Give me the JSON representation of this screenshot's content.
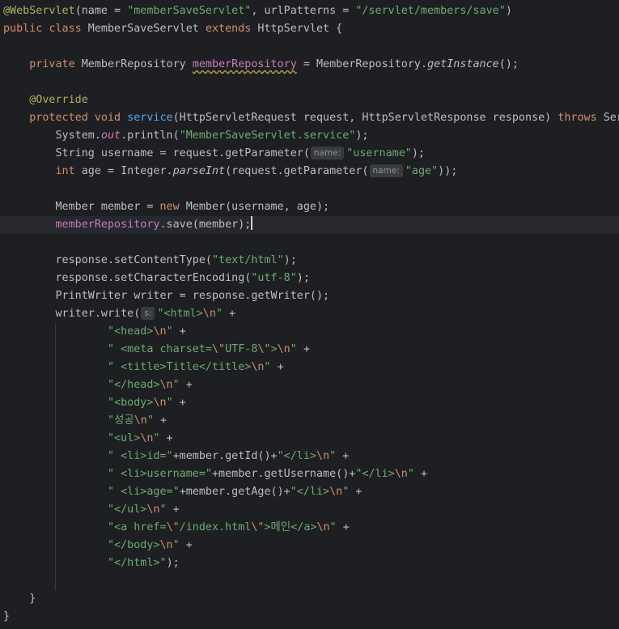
{
  "editor": {
    "lines": {
      "l1_annotation": "@WebServlet",
      "l1_open": "(name = ",
      "l1_name": "\"memberSaveServlet\"",
      "l1_mid": ", urlPatterns = ",
      "l1_url": "\"/servlet/members/save\"",
      "l1_close": ")",
      "l2_public": "public",
      "l2_class": "class",
      "l2_name": " MemberSaveServlet ",
      "l2_extends": "extends",
      "l2_rest": " HttpServlet {",
      "l4_private": "private",
      "l4_type": " MemberRepository ",
      "l4_field": "memberRepository",
      "l4_eq": " = MemberRepository.",
      "l4_call": "getInstance",
      "l4_end": "();",
      "l6_override": "@Override",
      "l7_protected": "protected",
      "l7_void": "void",
      "l7_service": "service",
      "l7_params": "(HttpServletRequest request, HttpServletResponse response) ",
      "l7_throws": "throws",
      "l7_rest": " Ser",
      "l8_a": "System.",
      "l8_out": "out",
      "l8_b": ".println(",
      "l8_str": "\"MemberSaveServlet.service\"",
      "l8_end": ");",
      "l9_a": "String username = request.getParameter(",
      "l9_hint": "name:",
      "l9_str": "\"username\"",
      "l9_end": ");",
      "l10_int": "int",
      "l10_a": " age = Integer.",
      "l10_parse": "parseInt",
      "l10_b": "(request.getParameter(",
      "l10_hint": "name:",
      "l10_str": "\"age\"",
      "l10_end": "));",
      "l12_a": "Member member = ",
      "l12_new": "new",
      "l12_b": " Member(username, age);",
      "l13_field": "memberRepository",
      "l13_rest": ".save(member);",
      "l15": "response.setContentType(",
      "l15_str": "\"text/html\"",
      "l15_end": ");",
      "l16": "response.setCharacterEncoding(",
      "l16_str": "\"utf-8\"",
      "l16_end": ");",
      "l17": "PrintWriter writer = response.getWriter();",
      "l18": "writer.write(",
      "l18_hint": "s:",
      "l18_str": "\"<html>",
      "esc_n": "\\n",
      "esc_q": "\\\"",
      "quote": "\"",
      "plus": " +",
      "plus_end": " +",
      "l19_str": "\"<head>",
      "l20_str": "\" <meta charset=",
      "l20_utf": "UTF-8",
      "l20_gt": ">",
      "l21_str": "\" <title>Title</title>",
      "l22_str": "\"</head>",
      "l23_str": "\"<body>",
      "l24_str": "\"성공",
      "l25_str": "\"<ul>",
      "l26_str": "\" <li>id=\"",
      "l26_mid": "+member.getId()+",
      "l26_str2": "\"</li>",
      "l27_str": "\" <li>username=\"",
      "l27_mid": "+member.getUsername()+",
      "l27_str2": "\"</li>",
      "l28_str": "\" <li>age=\"",
      "l28_mid": "+member.getAge()+",
      "l28_str2": "\"</li>",
      "l29_str": "\"</ul>",
      "l30_str": "\"<a href=",
      "l30_path": "/index.html",
      "l30_rest": ">메인</a>",
      "l31_str": "\"</body>",
      "l32_str": "\"</html>\"",
      "l32_end": ");",
      "l34": "}",
      "l35": "}"
    }
  }
}
